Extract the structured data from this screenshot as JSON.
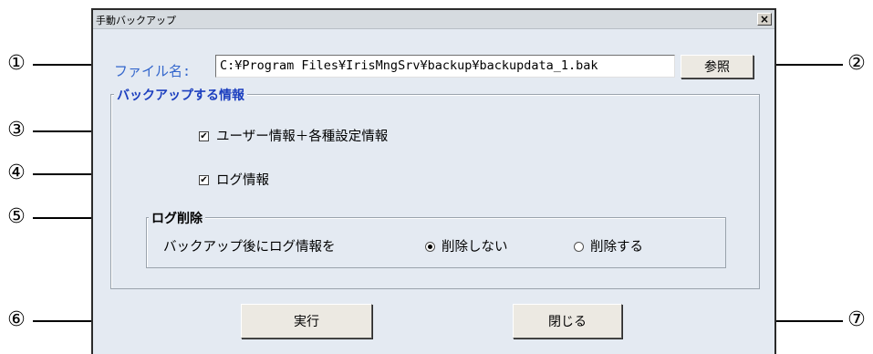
{
  "window": {
    "title": "手動バックアップ",
    "close_label": "×"
  },
  "file": {
    "label": "ファイル名:",
    "path": "C:¥Program Files¥IrisMngSrv¥backup¥backupdata_1.bak",
    "browse_label": "参照"
  },
  "backup_info": {
    "legend": "バックアップする情報",
    "user_settings": {
      "label": "ユーザー情報＋各種設定情報",
      "checked": true
    },
    "log_info": {
      "label": "ログ情報",
      "checked": true
    }
  },
  "log_delete": {
    "legend": "ログ削除",
    "description": "バックアップ後にログ情報を",
    "option_keep": {
      "label": "削除しない",
      "selected": true
    },
    "option_delete": {
      "label": "削除する",
      "selected": false
    }
  },
  "buttons": {
    "run_label": "実行",
    "close_label": "閉じる"
  },
  "callouts": [
    "①",
    "②",
    "③",
    "④",
    "⑤",
    "⑥",
    "⑦"
  ],
  "colors": {
    "accent": "#3366cc",
    "dialog_bg": "#e4eaf2"
  }
}
